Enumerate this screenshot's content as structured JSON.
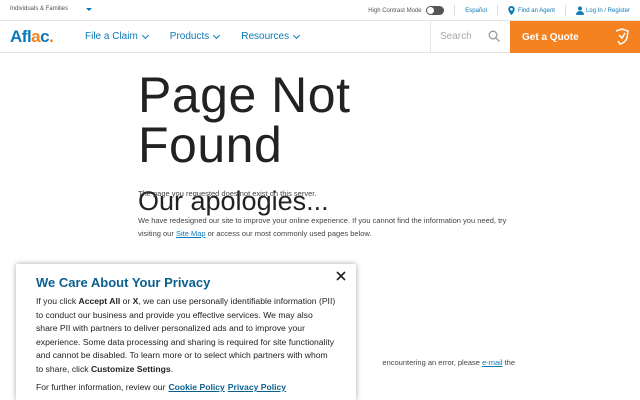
{
  "topbar": {
    "audience": "Individuals & Families",
    "high_contrast": "High Contrast Mode",
    "language": "Español",
    "find_agent": "Find an Agent",
    "login": "Log In / Register"
  },
  "nav": {
    "logo": "Aflac",
    "links": [
      "File a Claim",
      "Products",
      "Resources"
    ],
    "search_placeholder": "Search",
    "cta": "Get a Quote"
  },
  "page": {
    "title": "Page Not Found",
    "subtitle": "Our apologies...",
    "p1": "The page you requested does not exist on this server.",
    "p2_before": "We have redesigned our site to improve your online experience. If you cannot find the information you need, try visiting our ",
    "p2_link": "Site Map",
    "p2_after": " or access our most commonly used pages below.",
    "p3_before": "encountering an error, please ",
    "p3_link": "e-mail",
    "p3_after": " the"
  },
  "privacy": {
    "title": "We Care About Your Privacy",
    "t1": "If you click ",
    "b1": "Accept All",
    "t2": " or ",
    "b2": "X",
    "t3": ", we can use personally identifiable information (PII) to conduct our business and provide you effective services. We may also share PII with partners to deliver personalized ads and to improve your experience. Some data processing and sharing is required for site functionality and cannot be disabled. To learn more or to select which partners with whom to share, click ",
    "b3": "Customize Settings",
    "t4": ".",
    "review": "For further information, review our",
    "cookie_policy": "Cookie Policy",
    "privacy_policy": "Privacy Policy"
  },
  "colors": {
    "brand_blue": "#0b7ab8",
    "cta_orange": "#f58220"
  }
}
